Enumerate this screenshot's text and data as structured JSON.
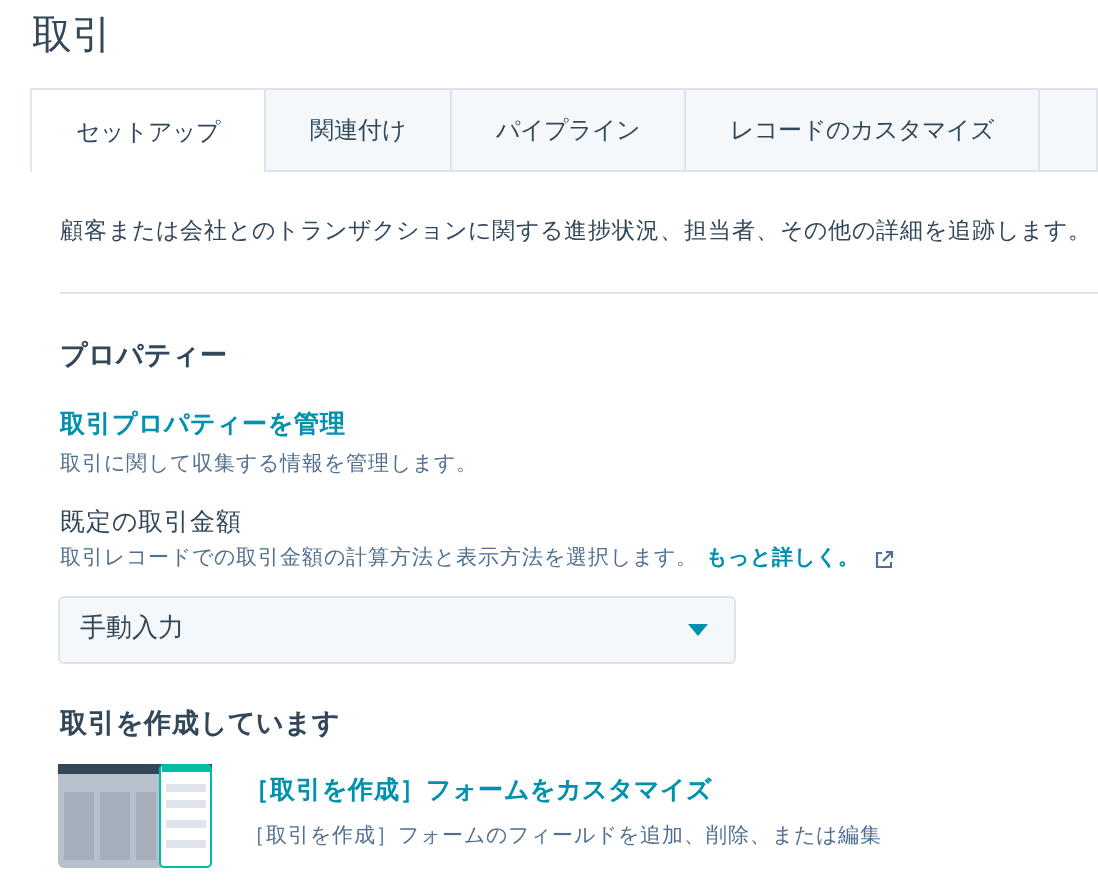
{
  "page_title": "取引",
  "tabs": [
    {
      "label": "セットアップ",
      "selected": true
    },
    {
      "label": "関連付け",
      "selected": false
    },
    {
      "label": "パイプライン",
      "selected": false
    },
    {
      "label": "レコードのカスタマイズ",
      "selected": false
    }
  ],
  "intro": "顧客または会社とのトランザクションに関する進捗状況、担当者、その他の詳細を追跡します。",
  "properties": {
    "heading": "プロパティー",
    "manage_link": "取引プロパティーを管理",
    "manage_help": "取引に関して収集する情報を管理します。",
    "amount_label": "既定の取引金額",
    "amount_help": "取引レコードでの取引金額の計算方法と表示方法を選択します。",
    "learn_more": "もっと詳しく。",
    "amount_select": {
      "value": "手動入力"
    }
  },
  "create": {
    "heading": "取引を作成しています",
    "link": "［取引を作成］フォームをカスタマイズ",
    "help": "［取引を作成］フォームのフィールドを追加、削除、または編集"
  }
}
